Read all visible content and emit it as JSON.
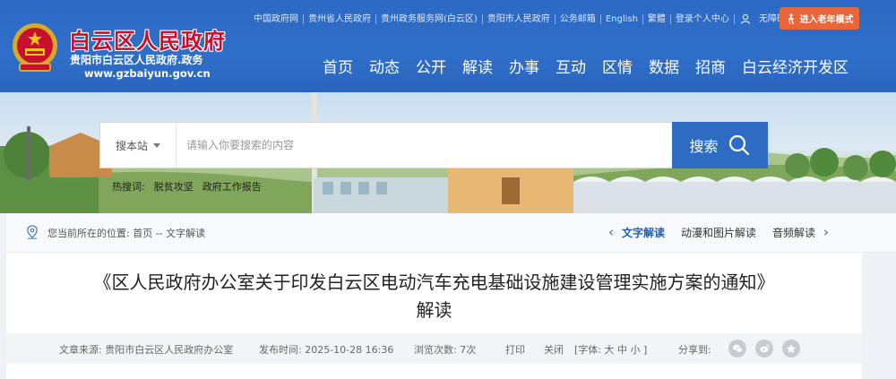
{
  "header": {
    "site_title": "白云区人民政府",
    "site_subtitle": "贵阳市白云区人民政府.政务",
    "site_domain": "www.gzbaiyun.gov.cn",
    "top_links": [
      "中国政府网",
      "贵州省人民政府",
      "贵州政务服务网(白云区)",
      "贵阳市人民政府",
      "公务邮箱",
      "English",
      "繁體",
      "登录个人中心"
    ],
    "accessibility": "无障碍浏览",
    "elder_mode": "进入老年模式",
    "nav": [
      "首页",
      "动态",
      "公开",
      "解读",
      "办事",
      "互动",
      "区情",
      "数据",
      "招商",
      "白云经济开发区"
    ]
  },
  "search": {
    "scope": "搜本站",
    "placeholder": "请输入你要搜索的内容",
    "button": "搜索",
    "hot_label": "热搜词:",
    "hot_words": [
      "脱贫攻坚",
      "政府工作报告"
    ]
  },
  "breadcrumb": {
    "location": "您当前所在的位置: 首页 -- 文字解读",
    "tabs": [
      "文字解读",
      "动漫和图片解读",
      "音频解读"
    ],
    "active_tab": "文字解读"
  },
  "article": {
    "title_line1": "《区人民政府办公室关于印发白云区电动汽车充电基础设施建设管理实施方案的通知》",
    "title_line2": "解读",
    "source": "文章来源: 贵阳市白云区人民政府办公室",
    "publish_time": "发布时间: 2025-10-28 16:36",
    "views": "浏览次数: 7次",
    "print": "打印",
    "close": "关闭",
    "font_size": "[字体: 大 中 小 ]",
    "share": "分享到:"
  },
  "colors": {
    "header_blue": "#2f6fc9",
    "title_red": "#c8102e",
    "elder_orange": "#e9663a",
    "search_blue": "#2e6cc4",
    "active_tab": "#1f5fb8"
  }
}
